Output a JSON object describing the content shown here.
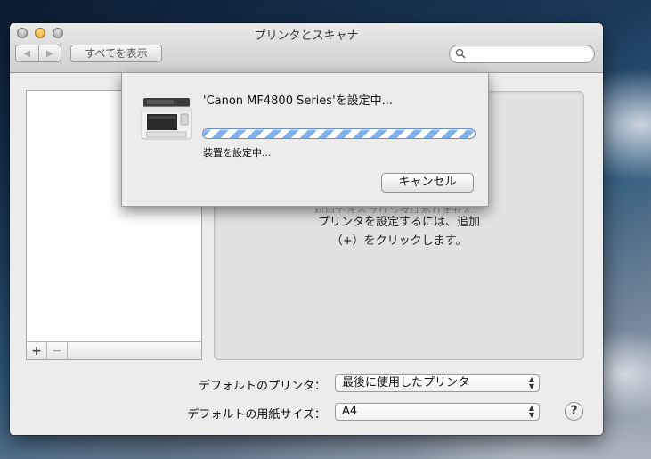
{
  "window": {
    "title": "プリンタとスキャナ",
    "nav_back": "◀",
    "nav_forward": "▶",
    "show_all_label": "すべてを表示",
    "search_placeholder": "",
    "search_value": ""
  },
  "printer_list": {
    "add_label": "+",
    "remove_label": "−"
  },
  "detail": {
    "partial_line": "利用できるプリンタはありません。",
    "line1": "プリンタを設定するには、追加",
    "line2": "（+）をクリックします。"
  },
  "defaults": {
    "printer_label": "デフォルトのプリンタ：",
    "printer_value": "最後に使用したプリンタ",
    "paper_label": "デフォルトの用紙サイズ：",
    "paper_value": "A4",
    "help_label": "?"
  },
  "sheet": {
    "title": "'Canon MF4800 Series'を設定中...",
    "status": "装置を設定中...",
    "cancel_label": "キャンセル",
    "progress": "indeterminate"
  },
  "icons": {
    "search": "search-icon",
    "printer": "printer-icon",
    "help": "help-icon"
  }
}
